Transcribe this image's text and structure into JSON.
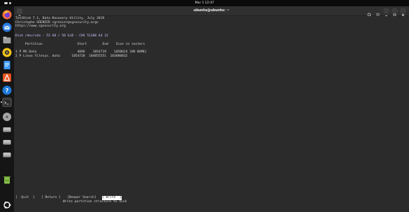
{
  "topbar": {
    "clock": "Mar 1  12:47"
  },
  "dock": {
    "apps": [
      {
        "name": "Firefox",
        "icon": "firefox-icon",
        "color": "#ff7139"
      },
      {
        "name": "Thunderbird",
        "icon": "thunderbird-icon",
        "color": "#2a7de1"
      },
      {
        "name": "Files",
        "icon": "files-icon",
        "color": "#8e8e8e"
      },
      {
        "name": "Rhythmbox",
        "icon": "rhythmbox-icon",
        "color": "#f0c419"
      },
      {
        "name": "LibreOffice Writer",
        "icon": "writer-icon",
        "color": "#1e88e5"
      },
      {
        "name": "App Center",
        "icon": "app-center-icon",
        "color": "#e95420"
      },
      {
        "name": "Help",
        "icon": "help-icon",
        "color": "#1f7adb"
      },
      {
        "name": "Terminal",
        "icon": "terminal-icon",
        "color": "#3a3a3a"
      },
      {
        "name": "Disk",
        "icon": "disk-icon",
        "color": "#9a9a9a"
      },
      {
        "name": "Drive",
        "icon": "drive-icon-1",
        "color": "#bdbdbd"
      },
      {
        "name": "Drive",
        "icon": "drive-icon-2",
        "color": "#bdbdbd"
      },
      {
        "name": "Drive",
        "icon": "drive-icon-3",
        "color": "#bdbdbd"
      },
      {
        "name": "Trash",
        "icon": "trash-icon",
        "color": "#7cb342"
      },
      {
        "name": "Show Apps",
        "icon": "ubuntu-logo-icon",
        "color": "#ffffff"
      }
    ]
  },
  "window": {
    "title": "ubuntu@ubuntu: ~"
  },
  "terminal": {
    "header": [
      "TestDisk 7.1, Data Recovery Utility, July 2019",
      "Christophe GRENIER <grenier@cgsecurity.org>",
      "https://www.cgsecurity.org"
    ],
    "disk_line": "Disk /dev/sda - 53 GB / 50 GiB - CHS 51200 64 32",
    "table_header": "     Partition                  Start        End    Size in sectors",
    "rows": [
      "1 P MS Data                     4096    1054719    1050624 [NO NAME]",
      "2 P Linux filesys. data      1054720  104855551  103800832"
    ],
    "menu": [
      "[  Quit  ]",
      "[ Return ]",
      "[Deeper Search]",
      "[ Write  ]"
    ],
    "selected_menu_index": 3,
    "hint": "Write partition structure to disk"
  }
}
